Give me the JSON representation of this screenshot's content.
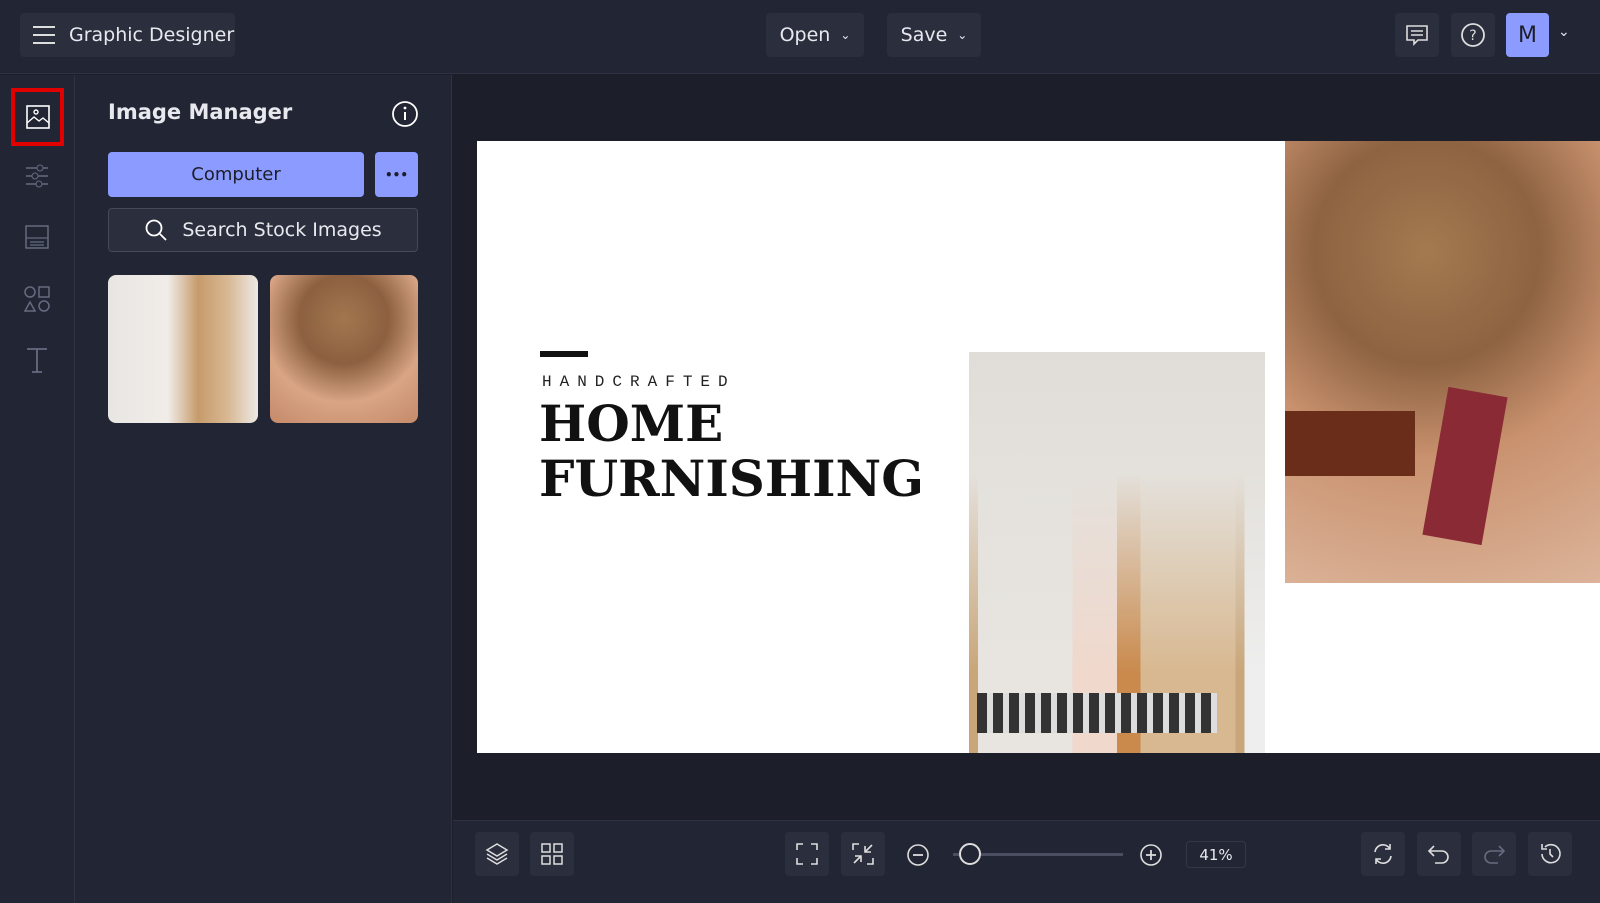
{
  "header": {
    "app_title": "Graphic Designer",
    "open_label": "Open",
    "save_label": "Save",
    "avatar_initial": "M"
  },
  "panel": {
    "title": "Image Manager",
    "computer_label": "Computer",
    "more_label": "•••",
    "search_label": "Search Stock Images"
  },
  "canvas": {
    "subtitle": "HANDCRAFTED",
    "title_line1": "HOME",
    "title_line2": "FURNISHING"
  },
  "bottom": {
    "zoom_percent": "41%",
    "zoom_level": 0.1
  },
  "colors": {
    "accent": "#8c9bff",
    "highlight": "#e00000"
  }
}
